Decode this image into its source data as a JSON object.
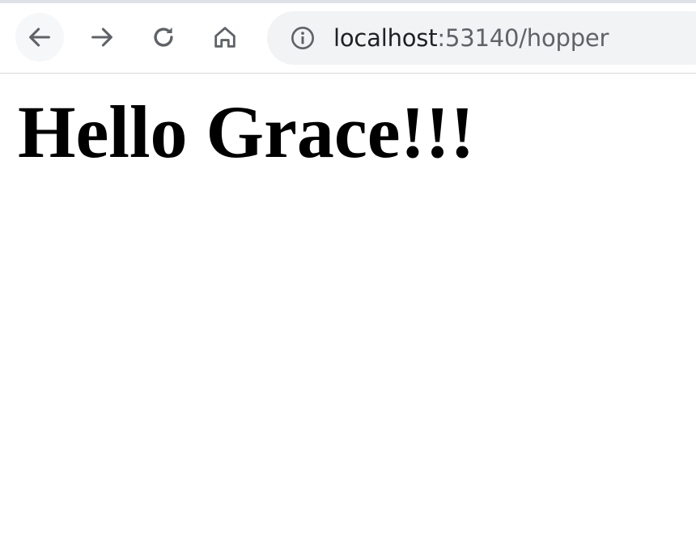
{
  "browser": {
    "address_bar": {
      "host": "localhost",
      "rest": ":53140/hopper"
    },
    "icons": {
      "back": "arrow-left-icon",
      "forward": "arrow-right-icon",
      "reload": "reload-icon",
      "home": "home-icon",
      "site_info": "info-icon"
    },
    "colors": {
      "toolbar_bg": "#ffffff",
      "omnibox_bg": "#f1f3f4",
      "icon": "#5f6368",
      "url_host": "#202124",
      "url_rest": "#5f6368"
    }
  },
  "page": {
    "heading": "Hello Grace!!!"
  }
}
